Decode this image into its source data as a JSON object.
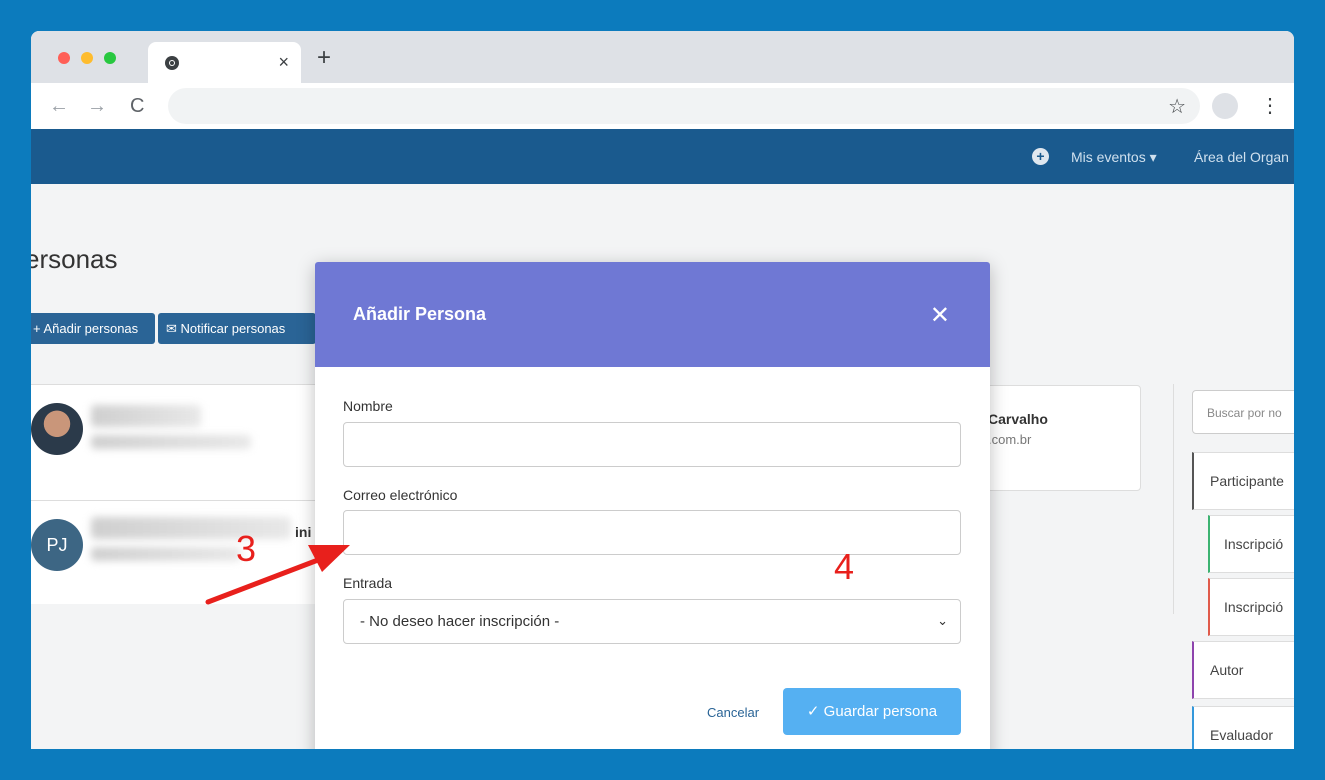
{
  "browser": {
    "tab_close": "×",
    "new_tab": "+",
    "nav_back": "←",
    "nav_forward": "→",
    "nav_reload": "C",
    "star": "☆",
    "kebab": "⋮"
  },
  "navbar": {
    "plus_icon": "+",
    "mis_eventos": "Mis eventos ▾",
    "area_organizador": "Área del Organ"
  },
  "page": {
    "title": "ersonas",
    "btn_anadir": "+ Añadir personas",
    "btn_notificar": "✉ Notificar personas",
    "avatar_initials": "PJ",
    "partial_text": "ini",
    "card_name": "Carvalho",
    "card_email": ".com.br",
    "search_placeholder": "Buscar por no",
    "sidebar": {
      "participantes": "Participante",
      "inscripcion_1": "Inscripció",
      "inscripcion_2": "Inscripció",
      "autor": "Autor",
      "evaluador": "Evaluador"
    }
  },
  "modal": {
    "title": "Añadir Persona",
    "close": "✕",
    "nombre_label": "Nombre",
    "nombre_value": "",
    "correo_label": "Correo electrónico",
    "correo_value": "",
    "entrada_label": "Entrada",
    "entrada_selected": "- No deseo hacer inscripción -",
    "cancel": "Cancelar",
    "save": "✓  Guardar persona"
  },
  "annotations": {
    "step3": "3",
    "step4": "4"
  }
}
